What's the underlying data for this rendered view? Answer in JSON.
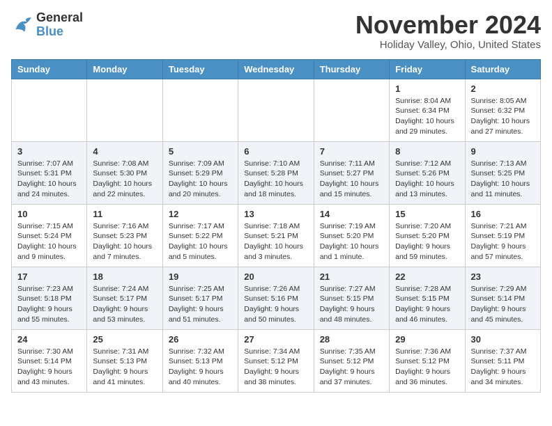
{
  "header": {
    "logo_line1": "General",
    "logo_line2": "Blue",
    "month": "November 2024",
    "location": "Holiday Valley, Ohio, United States"
  },
  "weekdays": [
    "Sunday",
    "Monday",
    "Tuesday",
    "Wednesday",
    "Thursday",
    "Friday",
    "Saturday"
  ],
  "weeks": [
    [
      {
        "day": "",
        "info": ""
      },
      {
        "day": "",
        "info": ""
      },
      {
        "day": "",
        "info": ""
      },
      {
        "day": "",
        "info": ""
      },
      {
        "day": "",
        "info": ""
      },
      {
        "day": "1",
        "info": "Sunrise: 8:04 AM\nSunset: 6:34 PM\nDaylight: 10 hours and 29 minutes."
      },
      {
        "day": "2",
        "info": "Sunrise: 8:05 AM\nSunset: 6:32 PM\nDaylight: 10 hours and 27 minutes."
      }
    ],
    [
      {
        "day": "3",
        "info": "Sunrise: 7:07 AM\nSunset: 5:31 PM\nDaylight: 10 hours and 24 minutes."
      },
      {
        "day": "4",
        "info": "Sunrise: 7:08 AM\nSunset: 5:30 PM\nDaylight: 10 hours and 22 minutes."
      },
      {
        "day": "5",
        "info": "Sunrise: 7:09 AM\nSunset: 5:29 PM\nDaylight: 10 hours and 20 minutes."
      },
      {
        "day": "6",
        "info": "Sunrise: 7:10 AM\nSunset: 5:28 PM\nDaylight: 10 hours and 18 minutes."
      },
      {
        "day": "7",
        "info": "Sunrise: 7:11 AM\nSunset: 5:27 PM\nDaylight: 10 hours and 15 minutes."
      },
      {
        "day": "8",
        "info": "Sunrise: 7:12 AM\nSunset: 5:26 PM\nDaylight: 10 hours and 13 minutes."
      },
      {
        "day": "9",
        "info": "Sunrise: 7:13 AM\nSunset: 5:25 PM\nDaylight: 10 hours and 11 minutes."
      }
    ],
    [
      {
        "day": "10",
        "info": "Sunrise: 7:15 AM\nSunset: 5:24 PM\nDaylight: 10 hours and 9 minutes."
      },
      {
        "day": "11",
        "info": "Sunrise: 7:16 AM\nSunset: 5:23 PM\nDaylight: 10 hours and 7 minutes."
      },
      {
        "day": "12",
        "info": "Sunrise: 7:17 AM\nSunset: 5:22 PM\nDaylight: 10 hours and 5 minutes."
      },
      {
        "day": "13",
        "info": "Sunrise: 7:18 AM\nSunset: 5:21 PM\nDaylight: 10 hours and 3 minutes."
      },
      {
        "day": "14",
        "info": "Sunrise: 7:19 AM\nSunset: 5:20 PM\nDaylight: 10 hours and 1 minute."
      },
      {
        "day": "15",
        "info": "Sunrise: 7:20 AM\nSunset: 5:20 PM\nDaylight: 9 hours and 59 minutes."
      },
      {
        "day": "16",
        "info": "Sunrise: 7:21 AM\nSunset: 5:19 PM\nDaylight: 9 hours and 57 minutes."
      }
    ],
    [
      {
        "day": "17",
        "info": "Sunrise: 7:23 AM\nSunset: 5:18 PM\nDaylight: 9 hours and 55 minutes."
      },
      {
        "day": "18",
        "info": "Sunrise: 7:24 AM\nSunset: 5:17 PM\nDaylight: 9 hours and 53 minutes."
      },
      {
        "day": "19",
        "info": "Sunrise: 7:25 AM\nSunset: 5:17 PM\nDaylight: 9 hours and 51 minutes."
      },
      {
        "day": "20",
        "info": "Sunrise: 7:26 AM\nSunset: 5:16 PM\nDaylight: 9 hours and 50 minutes."
      },
      {
        "day": "21",
        "info": "Sunrise: 7:27 AM\nSunset: 5:15 PM\nDaylight: 9 hours and 48 minutes."
      },
      {
        "day": "22",
        "info": "Sunrise: 7:28 AM\nSunset: 5:15 PM\nDaylight: 9 hours and 46 minutes."
      },
      {
        "day": "23",
        "info": "Sunrise: 7:29 AM\nSunset: 5:14 PM\nDaylight: 9 hours and 45 minutes."
      }
    ],
    [
      {
        "day": "24",
        "info": "Sunrise: 7:30 AM\nSunset: 5:14 PM\nDaylight: 9 hours and 43 minutes."
      },
      {
        "day": "25",
        "info": "Sunrise: 7:31 AM\nSunset: 5:13 PM\nDaylight: 9 hours and 41 minutes."
      },
      {
        "day": "26",
        "info": "Sunrise: 7:32 AM\nSunset: 5:13 PM\nDaylight: 9 hours and 40 minutes."
      },
      {
        "day": "27",
        "info": "Sunrise: 7:34 AM\nSunset: 5:12 PM\nDaylight: 9 hours and 38 minutes."
      },
      {
        "day": "28",
        "info": "Sunrise: 7:35 AM\nSunset: 5:12 PM\nDaylight: 9 hours and 37 minutes."
      },
      {
        "day": "29",
        "info": "Sunrise: 7:36 AM\nSunset: 5:12 PM\nDaylight: 9 hours and 36 minutes."
      },
      {
        "day": "30",
        "info": "Sunrise: 7:37 AM\nSunset: 5:11 PM\nDaylight: 9 hours and 34 minutes."
      }
    ]
  ]
}
